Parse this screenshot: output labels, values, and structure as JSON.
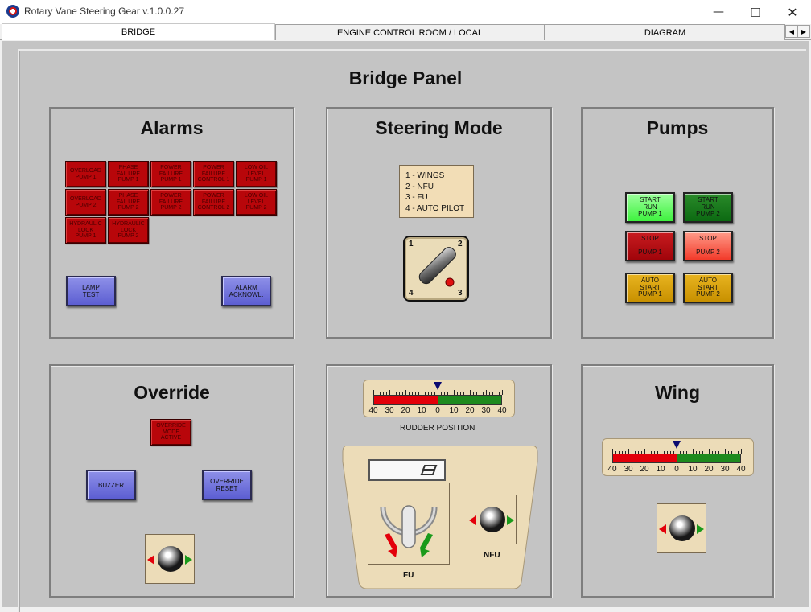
{
  "window": {
    "title": "Rotary Vane Steering Gear  v.1.0.0.27"
  },
  "tabs": [
    {
      "label": "BRIDGE",
      "active": true
    },
    {
      "label": "ENGINE CONTROL ROOM / LOCAL",
      "active": false
    },
    {
      "label": "DIAGRAM",
      "active": false
    }
  ],
  "page": {
    "title": "Bridge Panel"
  },
  "alarms": {
    "title": "Alarms",
    "lamps": [
      "OVERLOAD\nPUMP 1",
      "PHASE\nFAILURE\nPUMP 1",
      "POWER\nFAILURE\nPUMP 1",
      "POWER\nFAILURE\nCONTROL 1",
      "LOW OIL\nLEVEL\nPUMP 1",
      "OVERLOAD\nPUMP 2",
      "PHASE\nFAILURE\nPUMP 2",
      "POWER\nFAILURE\nPUMP 2",
      "POWER\nFAILURE\nCONTROL 2",
      "LOW OIL\nLEVEL\nPUMP 2",
      "HYDRAULIC\nLOCK\nPUMP 1",
      "HYDRAULIC\nLOCK\nPUMP 2"
    ],
    "lamp_test": "LAMP\nTEST",
    "alarm_ack": "ALARM\nACKNOWL."
  },
  "steering_mode": {
    "title": "Steering Mode",
    "modes": [
      "1 - WINGS",
      "2 - NFU",
      "3 - FU",
      "4 - AUTO PILOT"
    ],
    "selector_positions": [
      "1",
      "2",
      "3",
      "4"
    ]
  },
  "pumps": {
    "title": "Pumps",
    "start_pump1": "START\nRUN\nPUMP 1",
    "start_pump2": "START\nRUN\nPUMP 2",
    "stop_pump1": "STOP\n\nPUMP 1",
    "stop_pump2": "STOP\n\nPUMP 2",
    "auto_pump1": "AUTO\nSTART\nPUMP 1",
    "auto_pump2": "AUTO\nSTART\nPUMP 2"
  },
  "override": {
    "title": "Override",
    "mode_active": "OVERRIDE\nMODE\nACTIVE",
    "buzzer": "BUZZER",
    "reset": "OVERRIDE\nRESET"
  },
  "rudder": {
    "caption": "RUDDER  POSITION",
    "scale_labels": [
      "40",
      "30",
      "20",
      "10",
      "0",
      "10",
      "20",
      "30",
      "40"
    ],
    "position_deg": 0
  },
  "fu": {
    "caption": "FU"
  },
  "nfu": {
    "caption": "NFU"
  },
  "wing": {
    "title": "Wing",
    "scale_labels": [
      "40",
      "30",
      "20",
      "10",
      "0",
      "10",
      "20",
      "30",
      "40"
    ],
    "position_deg": 0
  },
  "colors": {
    "panel_bg": "#c4c4c4",
    "alarm_red": "#b8060a",
    "button_blue": "#6c6ee0",
    "start_lit": "#3ef23e",
    "start_dim": "#0c6a12",
    "stop_dim": "#b0060e",
    "stop_lit": "#f24a3a",
    "auto_amber": "#d8a008",
    "scale_red": "#e3000a",
    "scale_green": "#1e8a1e",
    "tan": "#ecdcb8"
  }
}
